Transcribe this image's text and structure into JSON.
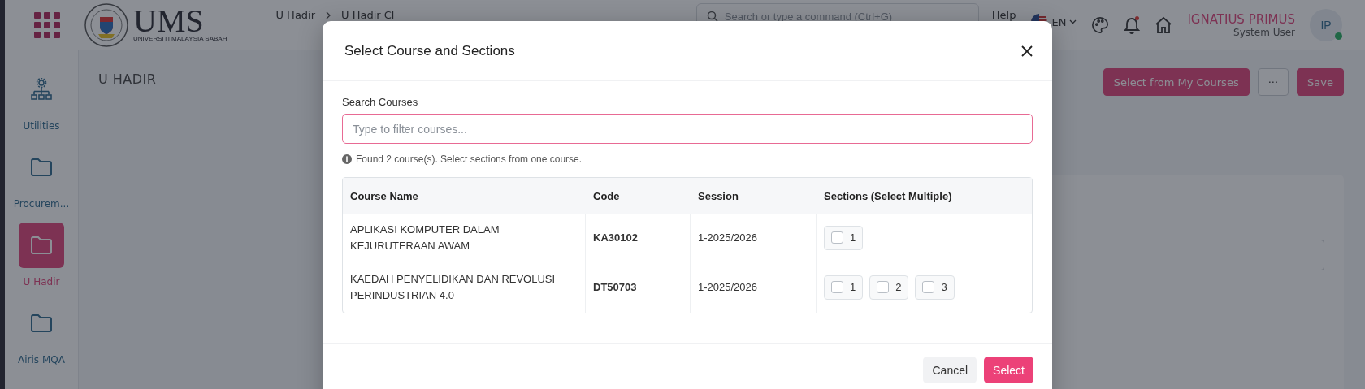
{
  "topbar": {
    "logo_text": "UMS",
    "logo_subtext": "UNIVERSITI MALAYSIA SABAH",
    "breadcrumbs": [
      {
        "label": "U Hadir"
      },
      {
        "label": "U Hadir Cl"
      }
    ],
    "search": {
      "placeholder": "Search or type a command (Ctrl+G)"
    },
    "help": "Help",
    "language": "EN",
    "notifications_unread": true,
    "user": {
      "name": "IGNATIUS PRIMUS",
      "role": "System User",
      "initials": "IP",
      "online": true
    }
  },
  "sidebar": {
    "items": [
      {
        "label": "Utilities",
        "kind": "tree",
        "selected": false
      },
      {
        "label": "Procurem...",
        "kind": "folder",
        "selected": false
      },
      {
        "label": "U Hadir",
        "kind": "folder",
        "selected": true
      },
      {
        "label": "Airis MQA",
        "kind": "folder",
        "selected": false
      }
    ]
  },
  "page": {
    "title": "U HADIR",
    "actions": [
      {
        "kind": "primary",
        "label": "Select from My Courses"
      },
      {
        "kind": "outline",
        "label": "···"
      },
      {
        "kind": "primary",
        "label": "Save"
      }
    ]
  },
  "dialog": {
    "title": "Select Course and Sections",
    "search_label": "Search Courses",
    "search_placeholder": "Type to filter courses...",
    "info": "Found 2 course(s). Select sections from one course.",
    "table": {
      "columns": [
        "Course Name",
        "Code",
        "Session",
        "Sections (Select Multiple)"
      ],
      "rows": [
        {
          "name": "APLIKASI KOMPUTER DALAM KEJURUTERAAN AWAM",
          "code": "KA30102",
          "session": "1-2025/2026",
          "sections": [
            {
              "label": "1",
              "checked": false
            }
          ]
        },
        {
          "name": "KAEDAH PENYELIDIKAN DAN REVOLUSI PERINDUSTRIAN 4.0",
          "code": "DT50703",
          "session": "1-2025/2026",
          "sections": [
            {
              "label": "1",
              "checked": false
            },
            {
              "label": "2",
              "checked": false
            },
            {
              "label": "3",
              "checked": false
            }
          ]
        }
      ]
    },
    "buttons": [
      {
        "kind": "secondary",
        "label": "Cancel"
      },
      {
        "kind": "primary",
        "label": "Select"
      }
    ]
  }
}
